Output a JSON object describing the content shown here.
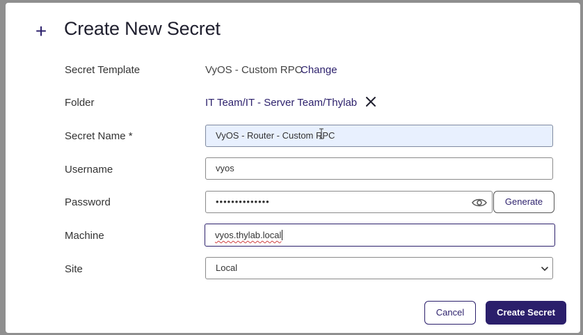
{
  "dialog": {
    "title": "Create New Secret",
    "plus_symbol": "+"
  },
  "form": {
    "secret_template": {
      "label": "Secret Template",
      "value": "VyOS - Custom RPC",
      "action": "Change"
    },
    "folder": {
      "label": "Folder",
      "value": "IT Team/IT - Server Team/Thylab"
    },
    "secret_name": {
      "label": "Secret Name *",
      "value": "VyOS - Router - Custom RPC"
    },
    "username": {
      "label": "Username",
      "value": "vyos"
    },
    "password": {
      "label": "Password",
      "value": "••••••••••••••",
      "generate_label": "Generate"
    },
    "machine": {
      "label": "Machine",
      "value": "vyos.thylab.local"
    },
    "site": {
      "label": "Site",
      "value": "Local"
    }
  },
  "footer": {
    "cancel_label": "Cancel",
    "create_label": "Create Secret"
  },
  "colors": {
    "accent": "#2b1f6b",
    "highlight_field": "#e8f0fe",
    "backdrop": "#8f8f8f"
  },
  "icons": {
    "add": "plus-icon",
    "remove_folder": "close-icon",
    "show_password": "eye-icon",
    "site_dropdown": "chevron-down-icon"
  }
}
